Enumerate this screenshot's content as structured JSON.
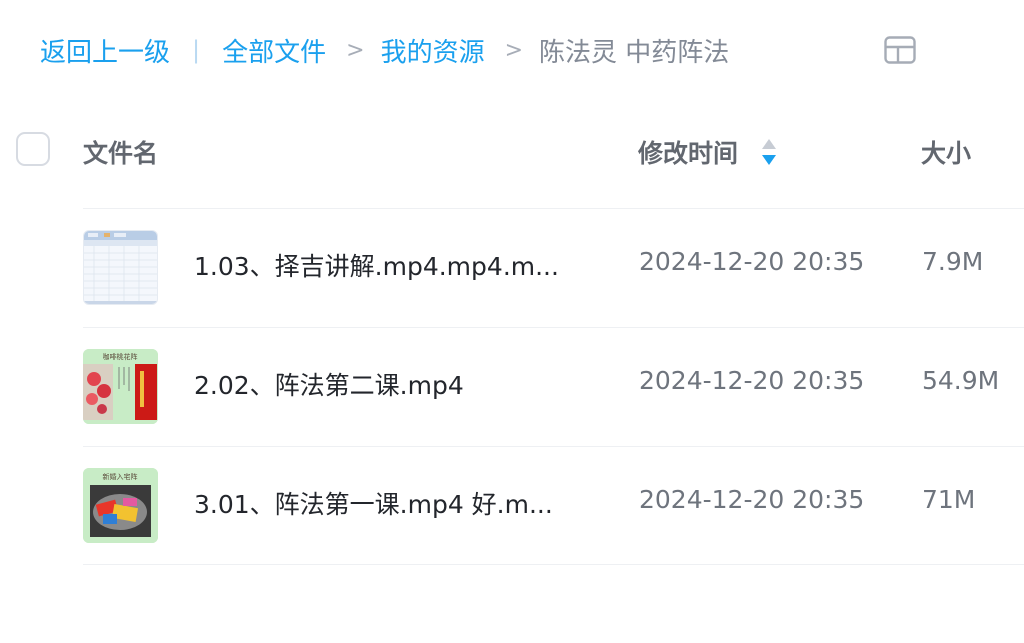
{
  "breadcrumb": {
    "back": "返回上一级",
    "divider": "|",
    "items": [
      "全部文件",
      "我的资源"
    ],
    "separator": ">",
    "current": "陈法灵 中药阵法"
  },
  "header": {
    "name": "文件名",
    "modified": "修改时间",
    "size": "大小"
  },
  "files": [
    {
      "name": "1.03、择吉讲解.mp4.mp4.m...",
      "modified": "2024-12-20 20:35",
      "size": "7.9M",
      "thumb_icon": "spreadsheet-thumbnail-icon"
    },
    {
      "name": "2.02、阵法第二课.mp4",
      "modified": "2024-12-20 20:35",
      "size": "54.9M",
      "thumb_icon": "video-thumbnail-icon",
      "thumb_caption": "咖啡桃花阵"
    },
    {
      "name": "3.01、阵法第一课.mp4 好.m...",
      "modified": "2024-12-20 20:35",
      "size": "71M",
      "thumb_icon": "video-thumbnail-icon",
      "thumb_caption": "新婚入宅阵"
    }
  ],
  "colors": {
    "accent": "#1aa0ee",
    "thumb_green": "#c8ecc6"
  }
}
